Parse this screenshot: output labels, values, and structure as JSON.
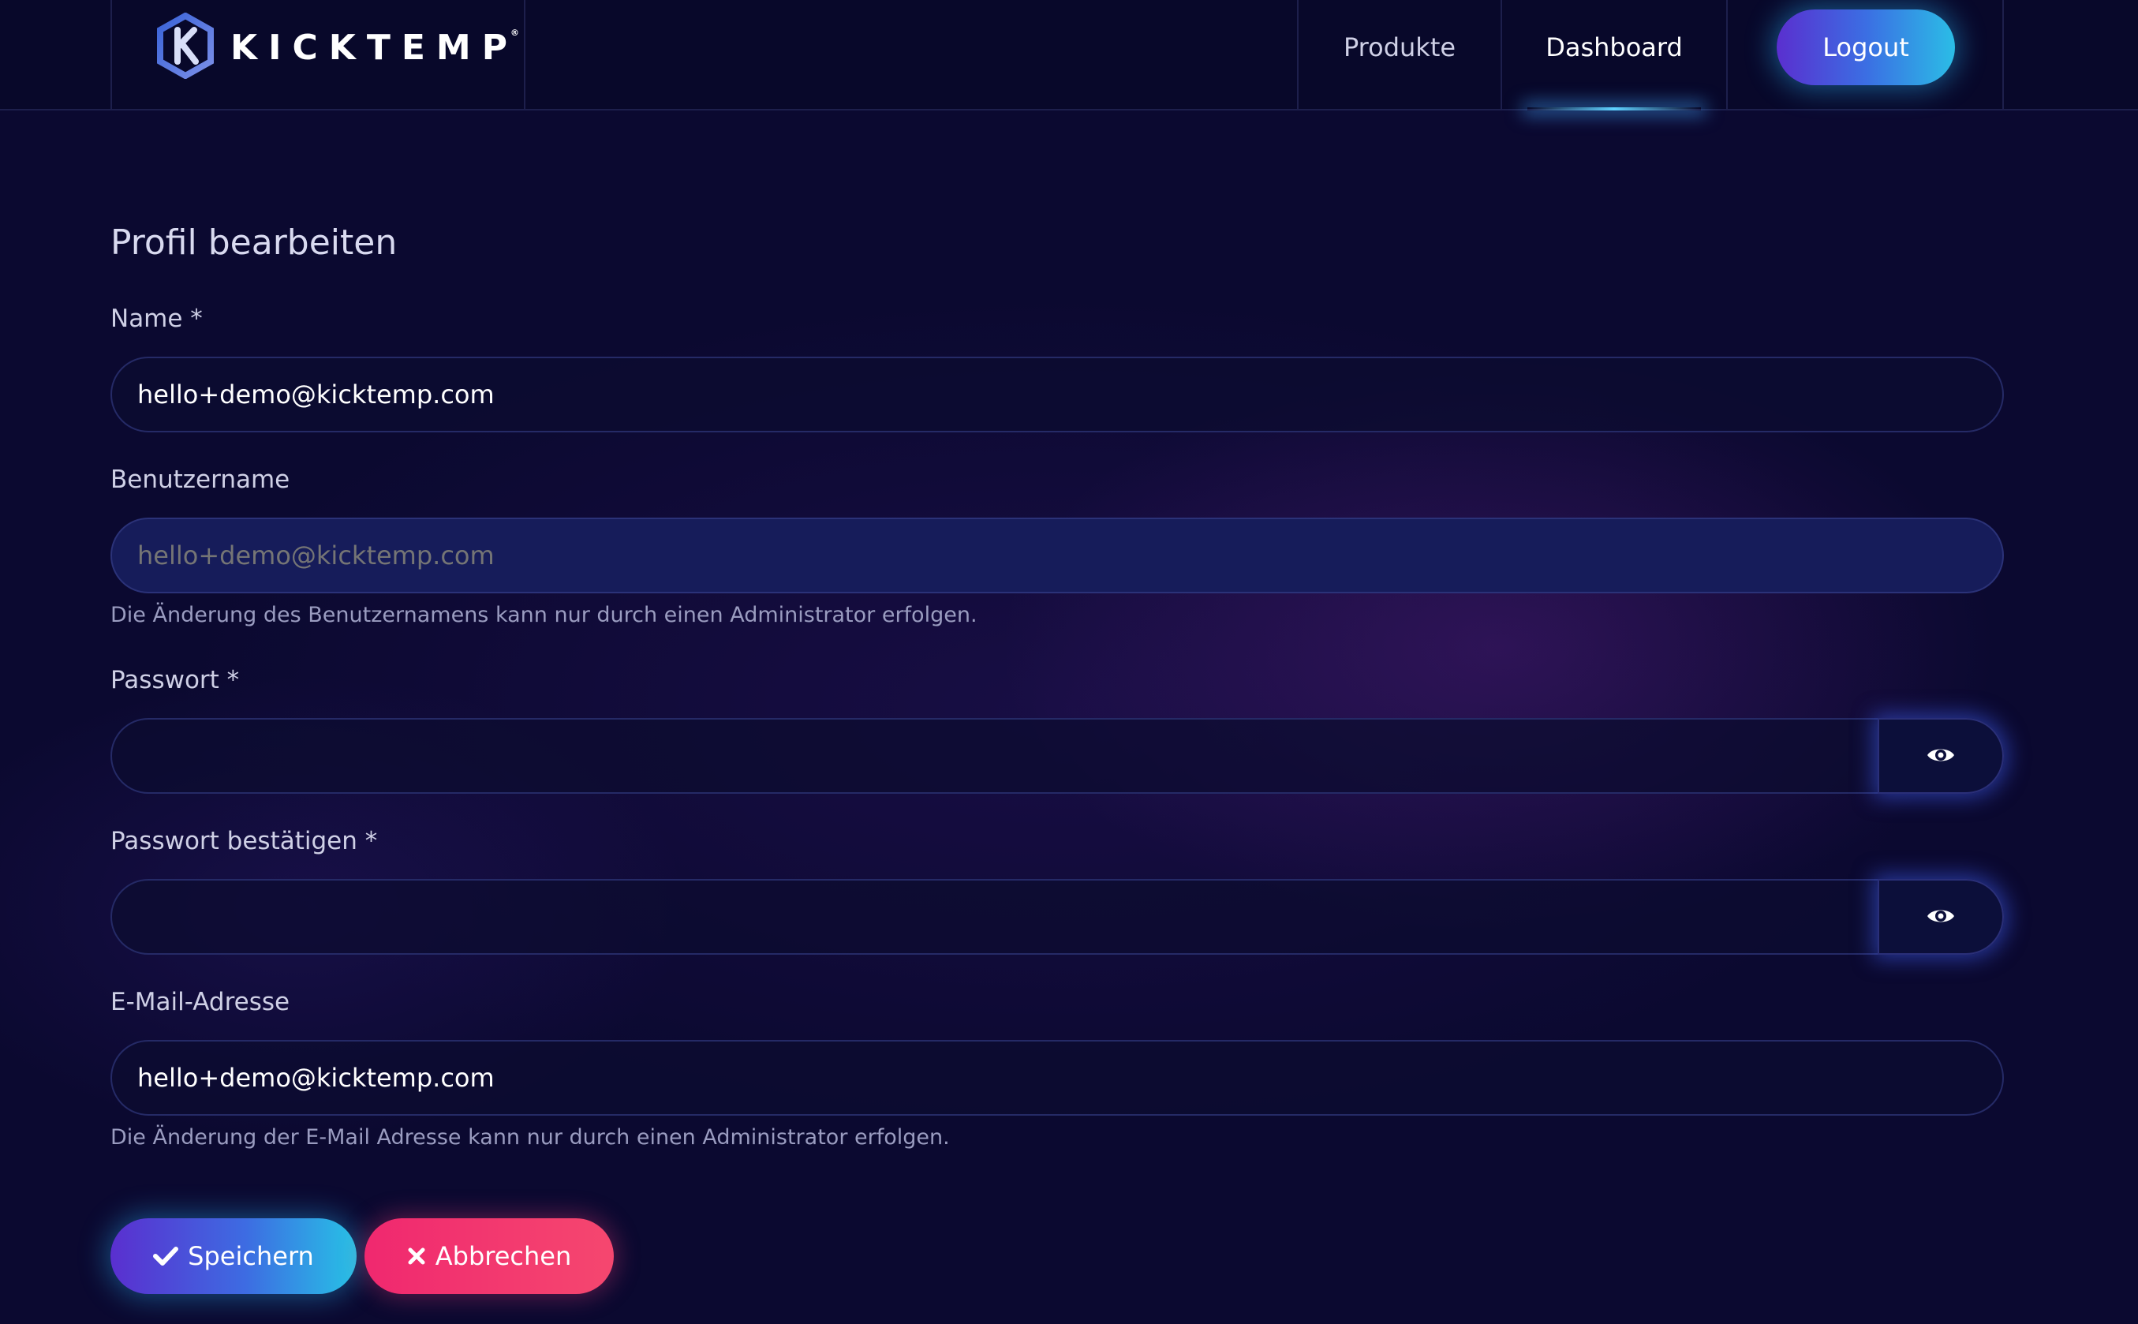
{
  "header": {
    "brand": "KICKTEMP",
    "brand_mark": "®",
    "logo_icon": "kicktemp-hexagon-logo",
    "nav": [
      {
        "label": "Produkte",
        "active": false
      },
      {
        "label": "Dashboard",
        "active": true
      }
    ],
    "logout_label": "Logout"
  },
  "form": {
    "title": "Profil bearbeiten",
    "name": {
      "label": "Name *",
      "value": "hello+demo@kicktemp.com"
    },
    "username": {
      "label": "Benutzername",
      "placeholder": "hello+demo@kicktemp.com",
      "help": "Die Änderung des Benutzernamens kann nur durch einen Administrator erfolgen."
    },
    "password": {
      "label": "Passwort *",
      "value": "",
      "toggle_icon": "eye-icon"
    },
    "password_confirm": {
      "label": "Passwort bestätigen *",
      "value": "",
      "toggle_icon": "eye-icon"
    },
    "email": {
      "label": "E-Mail-Adresse",
      "value": "hello+demo@kicktemp.com",
      "help": "Die Änderung der E-Mail Adresse kann nur durch einen Administrator erfolgen."
    },
    "save_label": "Speichern",
    "cancel_label": "Abbrechen"
  },
  "colors": {
    "background": "#0b0930",
    "primary_gradient_start": "#5a2fcf",
    "primary_gradient_end": "#27c2e6",
    "cancel": "#f0286f"
  }
}
